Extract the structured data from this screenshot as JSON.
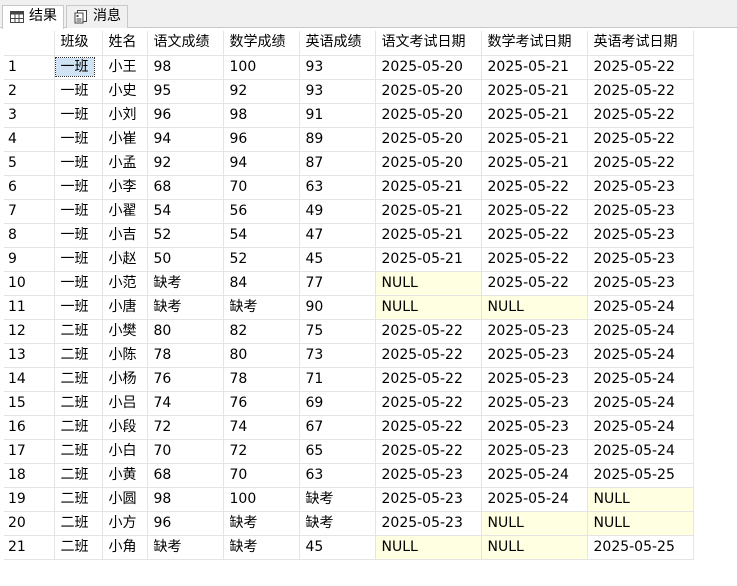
{
  "tabs": [
    {
      "label": "结果",
      "icon": "grid-icon",
      "active": true
    },
    {
      "label": "消息",
      "icon": "message-icon",
      "active": false
    }
  ],
  "grid": {
    "columns": [
      "班级",
      "姓名",
      "语文成绩",
      "数学成绩",
      "英语成绩",
      "语文考试日期",
      "数学考试日期",
      "英语考试日期"
    ],
    "null_color": "#ffffe1",
    "rows": [
      [
        "1",
        "一班",
        "小王",
        "98",
        "100",
        "93",
        "2025-05-20",
        "2025-05-21",
        "2025-05-22"
      ],
      [
        "2",
        "一班",
        "小史",
        "95",
        "92",
        "93",
        "2025-05-20",
        "2025-05-21",
        "2025-05-22"
      ],
      [
        "3",
        "一班",
        "小刘",
        "96",
        "98",
        "91",
        "2025-05-20",
        "2025-05-21",
        "2025-05-22"
      ],
      [
        "4",
        "一班",
        "小崔",
        "94",
        "96",
        "89",
        "2025-05-20",
        "2025-05-21",
        "2025-05-22"
      ],
      [
        "5",
        "一班",
        "小孟",
        "92",
        "94",
        "87",
        "2025-05-20",
        "2025-05-21",
        "2025-05-22"
      ],
      [
        "6",
        "一班",
        "小李",
        "68",
        "70",
        "63",
        "2025-05-21",
        "2025-05-22",
        "2025-05-23"
      ],
      [
        "7",
        "一班",
        "小翟",
        "54",
        "56",
        "49",
        "2025-05-21",
        "2025-05-22",
        "2025-05-23"
      ],
      [
        "8",
        "一班",
        "小吉",
        "52",
        "54",
        "47",
        "2025-05-21",
        "2025-05-22",
        "2025-05-23"
      ],
      [
        "9",
        "一班",
        "小赵",
        "50",
        "52",
        "45",
        "2025-05-21",
        "2025-05-22",
        "2025-05-23"
      ],
      [
        "10",
        "一班",
        "小范",
        "缺考",
        "84",
        "77",
        "NULL",
        "2025-05-22",
        "2025-05-23"
      ],
      [
        "11",
        "一班",
        "小唐",
        "缺考",
        "缺考",
        "90",
        "NULL",
        "NULL",
        "2025-05-24"
      ],
      [
        "12",
        "二班",
        "小樊",
        "80",
        "82",
        "75",
        "2025-05-22",
        "2025-05-23",
        "2025-05-24"
      ],
      [
        "13",
        "二班",
        "小陈",
        "78",
        "80",
        "73",
        "2025-05-22",
        "2025-05-23",
        "2025-05-24"
      ],
      [
        "14",
        "二班",
        "小杨",
        "76",
        "78",
        "71",
        "2025-05-22",
        "2025-05-23",
        "2025-05-24"
      ],
      [
        "15",
        "二班",
        "小吕",
        "74",
        "76",
        "69",
        "2025-05-22",
        "2025-05-23",
        "2025-05-24"
      ],
      [
        "16",
        "二班",
        "小段",
        "72",
        "74",
        "67",
        "2025-05-22",
        "2025-05-23",
        "2025-05-24"
      ],
      [
        "17",
        "二班",
        "小白",
        "70",
        "72",
        "65",
        "2025-05-22",
        "2025-05-23",
        "2025-05-24"
      ],
      [
        "18",
        "二班",
        "小黄",
        "68",
        "70",
        "63",
        "2025-05-23",
        "2025-05-24",
        "2025-05-25"
      ],
      [
        "19",
        "二班",
        "小圆",
        "98",
        "100",
        "缺考",
        "2025-05-23",
        "2025-05-24",
        "NULL"
      ],
      [
        "20",
        "二班",
        "小方",
        "96",
        "缺考",
        "缺考",
        "2025-05-23",
        "NULL",
        "NULL"
      ],
      [
        "21",
        "二班",
        "小角",
        "缺考",
        "缺考",
        "45",
        "NULL",
        "NULL",
        "2025-05-25"
      ]
    ]
  }
}
